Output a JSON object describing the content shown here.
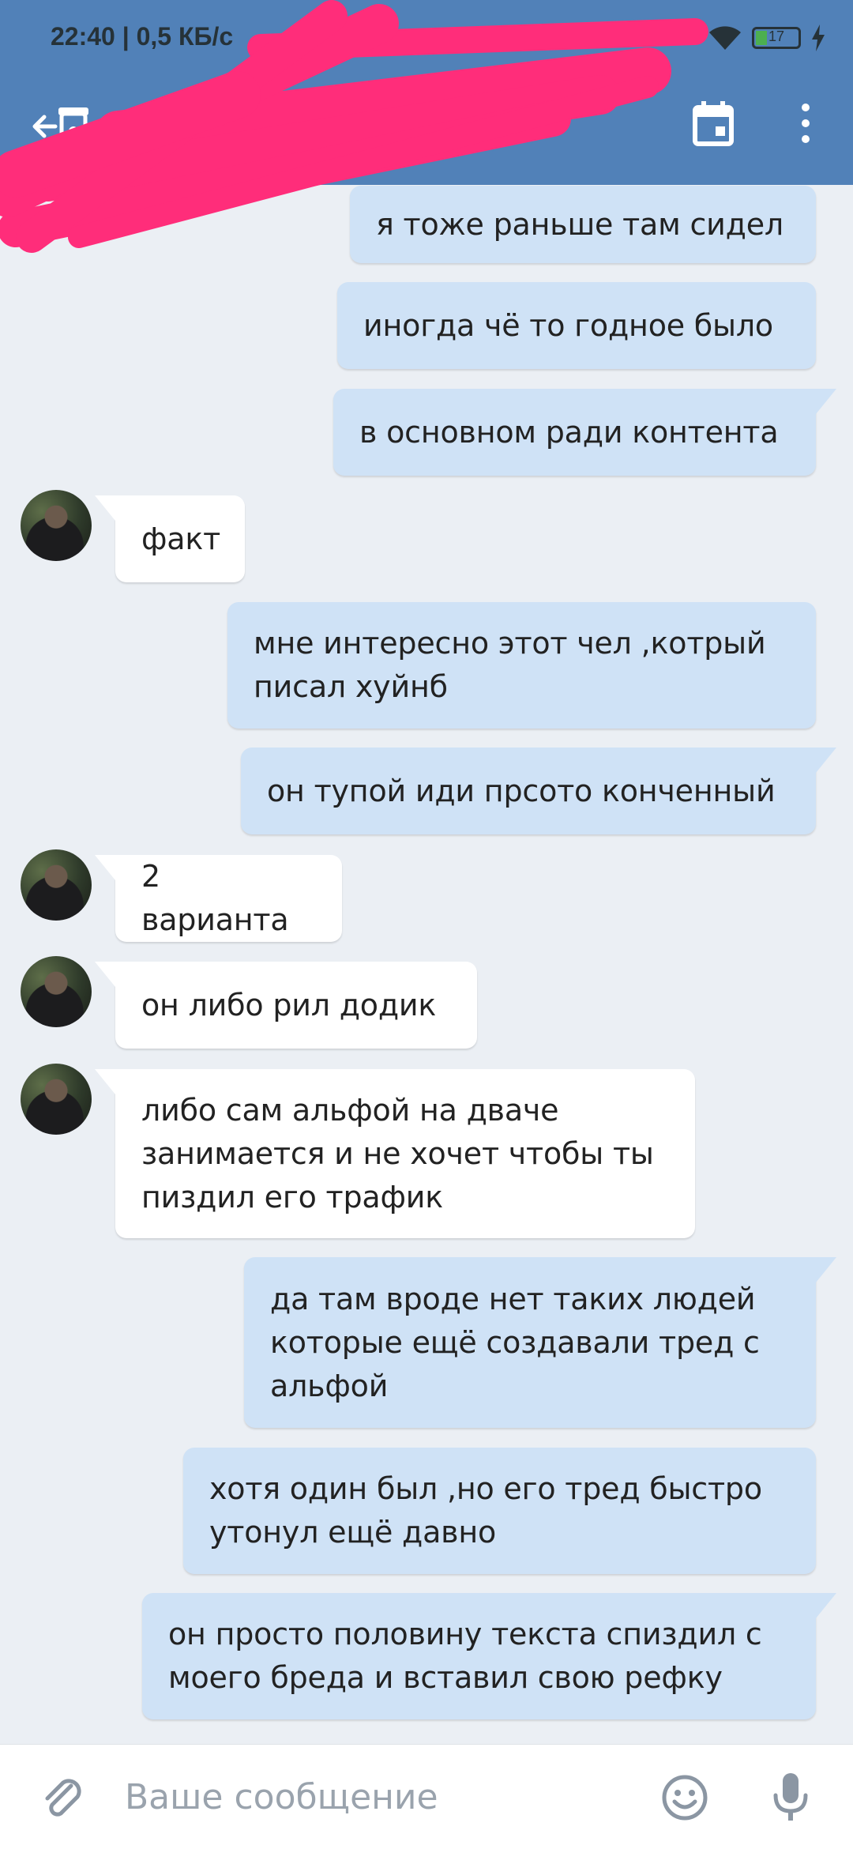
{
  "status_bar": {
    "time": "22:40",
    "net_speed": "0,5 КБ/с",
    "battery_level": "17"
  },
  "header": {
    "title": "",
    "subtitle": "",
    "color": "#5181b8"
  },
  "messages": [
    {
      "direction": "out",
      "text": "я тоже раньше там сидел"
    },
    {
      "direction": "out",
      "text": "иногда чё то годное было"
    },
    {
      "direction": "out",
      "text": "в основном ради контента"
    },
    {
      "direction": "in",
      "text": "факт"
    },
    {
      "direction": "out",
      "text": "мне интересно этот чел ,котрый\nписал хуйнб"
    },
    {
      "direction": "out",
      "text": "он тупой иди прсото конченный"
    },
    {
      "direction": "in",
      "text": "2 варианта"
    },
    {
      "direction": "in",
      "text": "он либо рил додик"
    },
    {
      "direction": "in",
      "text": "либо сам альфой на дваче\nзанимается и не хочет чтобы ты\nпиздил его трафик"
    },
    {
      "direction": "out",
      "text": "да там вроде нет таких людей\nкоторые ещё создавали тред с\nальфой"
    },
    {
      "direction": "out",
      "text": "хотя один был ,но его тред быстро\nутонул ещё давно"
    },
    {
      "direction": "out",
      "text": "он просто половину текста спиздил с\nмоего бреда и вставил свою рефку"
    }
  ],
  "composer": {
    "placeholder": "Ваше сообщение"
  },
  "icons": [
    "back-icon",
    "calendar-icon",
    "more-vert-icon",
    "attach-icon",
    "emoji-icon",
    "mic-icon",
    "wifi-icon",
    "battery-icon",
    "charging-icon"
  ],
  "colors": {
    "outgoing_bubble": "#cfe2f6",
    "incoming_bubble": "#ffffff",
    "background": "#ebeff4",
    "redaction": "#ff2d7a"
  }
}
